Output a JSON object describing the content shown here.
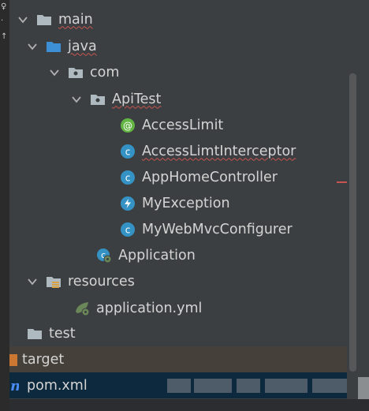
{
  "tree": {
    "items": [
      {
        "label": "main",
        "icon": "folder-icon",
        "expanded": true,
        "underline": true
      },
      {
        "label": "java",
        "icon": "source-folder-icon",
        "expanded": true,
        "underline": true
      },
      {
        "label": "com",
        "icon": "package-icon",
        "expanded": true,
        "underline": false
      },
      {
        "label": "ApiTest",
        "icon": "package-icon",
        "expanded": true,
        "underline": true
      },
      {
        "label": "AccessLimit",
        "icon": "annotation-icon",
        "underline": false
      },
      {
        "label": "AccessLimtInterceptor",
        "icon": "class-icon",
        "underline": true
      },
      {
        "label": "AppHomeController",
        "icon": "class-icon",
        "underline": false
      },
      {
        "label": "MyException",
        "icon": "exception-icon",
        "underline": false
      },
      {
        "label": "MyWebMvcConfigurer",
        "icon": "class-icon",
        "underline": false
      },
      {
        "label": "Application",
        "icon": "spring-boot-class-icon",
        "underline": false
      },
      {
        "label": "resources",
        "icon": "resources-folder-icon",
        "expanded": true,
        "underline": false
      },
      {
        "label": "application.yml",
        "icon": "spring-yml-icon",
        "underline": false
      },
      {
        "label": "test",
        "icon": "folder-icon",
        "underline": false
      },
      {
        "label": "target",
        "icon": "excluded-folder-icon",
        "underline": false
      },
      {
        "label": "pom.xml",
        "icon": "maven-icon",
        "underline": false
      }
    ]
  },
  "colors": {
    "panel_bg": "#3c3f41",
    "text": "#d4d4d4",
    "folder": "#aeb9c0",
    "source_folder": "#3d8fd6",
    "class_icon": "#3592c4",
    "annotation_icon": "#62b543",
    "exception_icon": "#3592c4",
    "target_folder": "#cc7832",
    "maven": "#4a8cf7",
    "selection_target": "#45403a",
    "selection_pom": "#0d293e",
    "error_underline": "#c75450"
  }
}
